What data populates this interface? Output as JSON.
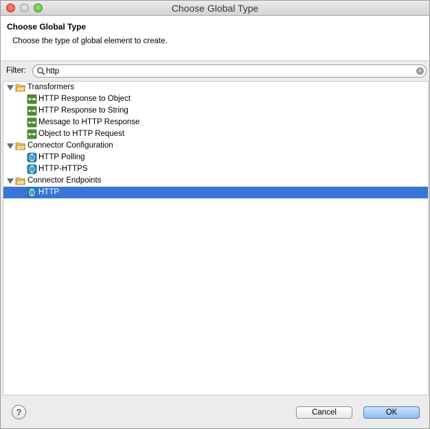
{
  "window": {
    "title": "Choose Global Type"
  },
  "header": {
    "title": "Choose Global Type",
    "description": "Choose the type of global element to create."
  },
  "filter": {
    "label": "Filter:",
    "value": "http"
  },
  "tree": {
    "groups": [
      {
        "label": "Transformers",
        "icon": "folder-open-icon",
        "items": [
          {
            "label": "HTTP Response to Object",
            "icon": "transformer-icon"
          },
          {
            "label": "HTTP Response to String",
            "icon": "transformer-icon"
          },
          {
            "label": "Message to HTTP Response",
            "icon": "transformer-icon"
          },
          {
            "label": "Object to HTTP Request",
            "icon": "transformer-icon"
          }
        ]
      },
      {
        "label": "Connector Configuration",
        "icon": "folder-open-icon",
        "items": [
          {
            "label": "HTTP Polling",
            "icon": "http-connector-icon"
          },
          {
            "label": "HTTP-HTTPS",
            "icon": "http-connector-icon"
          }
        ]
      },
      {
        "label": "Connector Endpoints",
        "icon": "folder-open-icon",
        "items": [
          {
            "label": "HTTP",
            "icon": "http-connector-icon",
            "selected": true
          }
        ]
      }
    ]
  },
  "buttons": {
    "cancel": "Cancel",
    "ok": "OK"
  },
  "colors": {
    "selection": "#3875d7",
    "ok_button": "#8ebbf2",
    "transformer": "#4e8a3a",
    "connector": "#1d7fa8"
  }
}
